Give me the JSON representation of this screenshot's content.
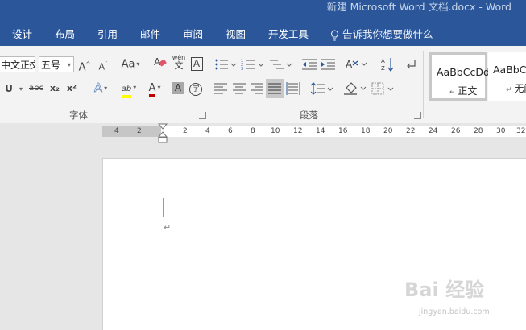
{
  "window": {
    "title": "新建 Microsoft Word 文档.docx  -  Word"
  },
  "tabs": {
    "design": "设计",
    "layout": "布局",
    "references": "引用",
    "mailings": "邮件",
    "review": "审阅",
    "view": "视图",
    "developer": "开发工具",
    "tell_me": "告诉我你想要做什么"
  },
  "font_group": {
    "label": "字体",
    "font_name": "中文正文",
    "font_size": "五号",
    "grow_label": "A",
    "shrink_label": "A",
    "case_label": "Aa",
    "phonetic_top": "wén",
    "phonetic_bottom": "文",
    "border_char": "A",
    "underline_label": "U",
    "strike_label": "abc",
    "sub_label": "x₂",
    "sup_label": "x²",
    "effects_label": "A",
    "highlight_label": "ab",
    "font_color_label": "A",
    "shading_label": "A",
    "enclose_label": "字",
    "highlight_color": "#ffff00",
    "font_color": "#c00000"
  },
  "paragraph_group": {
    "label": "段落"
  },
  "styles_group": {
    "items": [
      {
        "sample": "AaBbCcDd",
        "name": "正文"
      },
      {
        "sample": "AaBbCcDd",
        "name": "无间"
      }
    ]
  },
  "ruler": {
    "left_numbers": [
      "4",
      "2"
    ],
    "right_numbers": [
      "2",
      "4",
      "6",
      "8",
      "10",
      "12",
      "14",
      "16",
      "18",
      "20",
      "22",
      "24",
      "26",
      "28",
      "30",
      "32"
    ]
  },
  "document": {
    "paragraph_mark": "↵"
  },
  "watermark": {
    "text": "Bai 经验",
    "url": "jingyan.baidu.com"
  },
  "colors": {
    "title_bar": "#2b579a",
    "ribbon_bg": "#f3f3f3",
    "canvas_bg": "#e6e6e6"
  }
}
